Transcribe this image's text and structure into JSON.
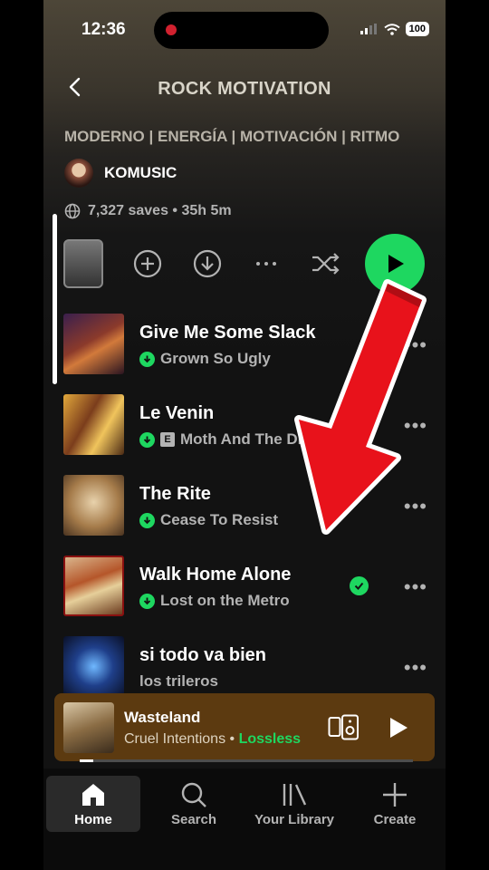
{
  "status_bar": {
    "time": "12:36",
    "battery": "100"
  },
  "header": {
    "title": "ROCK MOTIVATION"
  },
  "playlist": {
    "description": "MODERNO | ENERGÍA | MOTIVACIÓN | RITMO",
    "owner": "KOMUSIC",
    "meta": "7,327 saves • 35h 5m"
  },
  "tracks": [
    {
      "title": "Give Me Some Slack",
      "artist": "Grown So Ugly",
      "downloaded": true,
      "explicit": false
    },
    {
      "title": "Le Venin",
      "artist": "Moth And The Dragon...",
      "downloaded": true,
      "explicit": true,
      "explicit_label": "E"
    },
    {
      "title": "The Rite",
      "artist": "Cease To Resist",
      "downloaded": true,
      "explicit": false
    },
    {
      "title": "Walk Home Alone",
      "artist": "Lost on the Metro",
      "downloaded": true,
      "explicit": false,
      "saved": true
    },
    {
      "title": "si todo va bien",
      "artist": "los trileros",
      "downloaded": false,
      "explicit": false
    }
  ],
  "now_playing": {
    "title": "Wasteland",
    "artist": "Cruel Intentions",
    "separator": " • ",
    "quality": "Lossless",
    "progress": 0.04
  },
  "tabs": [
    {
      "label": "Home",
      "icon": "home-icon",
      "active": true
    },
    {
      "label": "Search",
      "icon": "search-icon",
      "active": false
    },
    {
      "label": "Your Library",
      "icon": "library-icon",
      "active": false
    },
    {
      "label": "Create",
      "icon": "plus-icon",
      "active": false
    }
  ],
  "colors": {
    "accent": "#1ed760",
    "now_playing_bg": "#5c3a10",
    "annotation_arrow": "#e8121b"
  },
  "more_glyph": "•••"
}
